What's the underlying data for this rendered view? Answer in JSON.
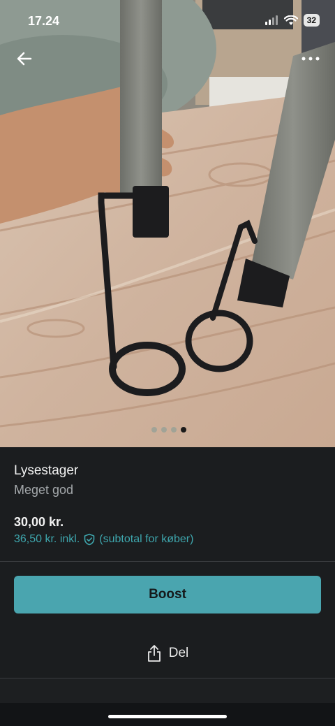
{
  "status_bar": {
    "time": "17.24",
    "battery": "32"
  },
  "gallery": {
    "image_count": 4,
    "active_index": 3
  },
  "listing": {
    "title": "Lysestager",
    "condition": "Meget god",
    "price": "30,00 kr.",
    "buyer_price": "36,50 kr. inkl.",
    "buyer_note": "(subtotal for køber)"
  },
  "actions": {
    "boost_label": "Boost",
    "share_label": "Del"
  },
  "colors": {
    "accent": "#4aa5af",
    "link": "#3ea6ad",
    "background": "#1b1d1f"
  },
  "icons": [
    "arrow-left-icon",
    "more-horizontal-icon",
    "shield-check-icon",
    "share-icon",
    "wifi-icon",
    "signal-icon"
  ]
}
